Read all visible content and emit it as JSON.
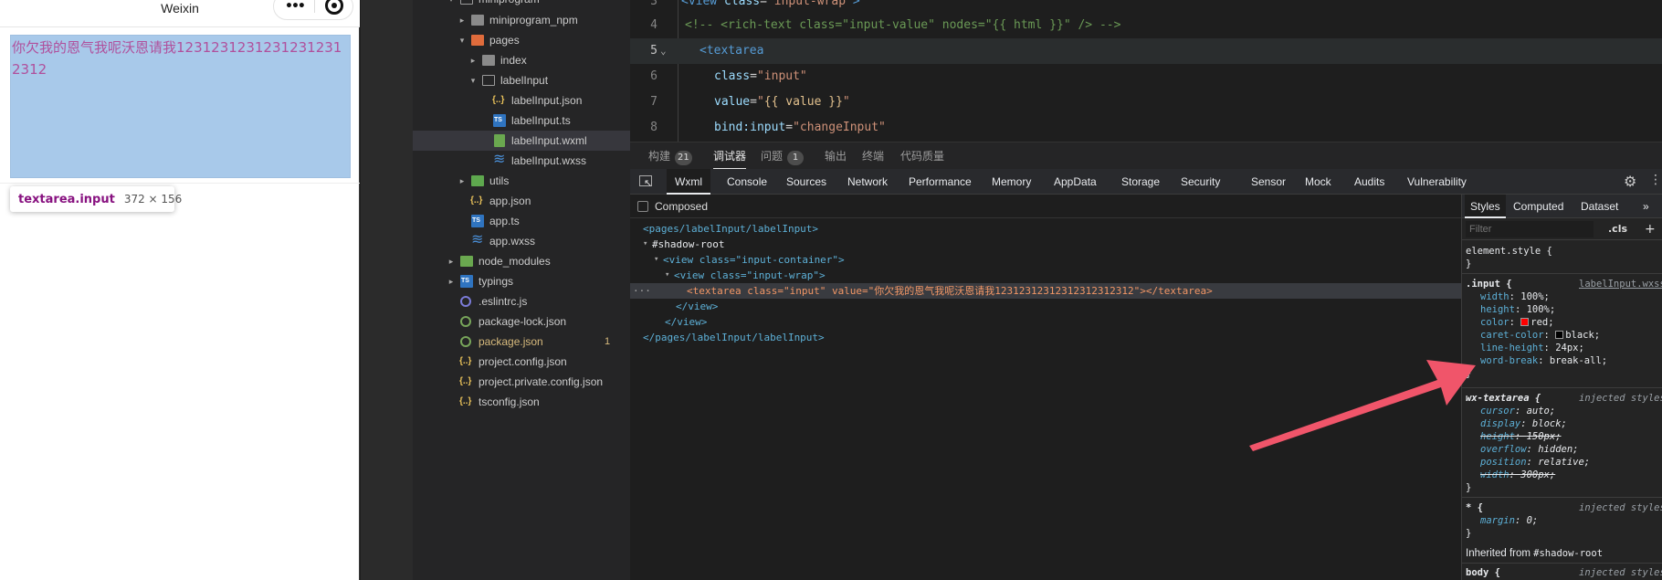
{
  "simulator": {
    "title": "Weixin",
    "textarea_value": "你欠我的恩气我呢沃恩请我12312312312312312312312",
    "tooltip_tag": "textarea.input",
    "tooltip_size": "372 × 156"
  },
  "explorer": {
    "items": [
      {
        "label": "miniprogram_npm"
      },
      {
        "label": "pages"
      },
      {
        "label": "index"
      },
      {
        "label": "labelInput"
      },
      {
        "label": "labelInput.json"
      },
      {
        "label": "labelInput.ts"
      },
      {
        "label": "labelInput.wxml"
      },
      {
        "label": "labelInput.wxss"
      },
      {
        "label": "utils"
      },
      {
        "label": "app.json"
      },
      {
        "label": "app.ts"
      },
      {
        "label": "app.wxss"
      },
      {
        "label": "node_modules"
      },
      {
        "label": "typings"
      },
      {
        "label": ".eslintrc.js"
      },
      {
        "label": "package-lock.json"
      },
      {
        "label": "package.json",
        "badge": "1"
      },
      {
        "label": "project.config.json"
      },
      {
        "label": "project.private.config.json"
      },
      {
        "label": "tsconfig.json"
      }
    ],
    "cut_top_label": "miniprogram"
  },
  "editor": {
    "lines": [
      {
        "num": "3",
        "segments": [
          [
            "c-tag",
            "<view "
          ],
          [
            "c-attr",
            "class"
          ],
          [
            "c-plain",
            "="
          ],
          [
            "c-str",
            "\"input-wrap\""
          ],
          [
            "c-tag",
            ">"
          ]
        ]
      },
      {
        "num": "4",
        "segments": [
          [
            "c-cmt",
            "<!-- <rich-text class=\"input-value\" nodes=\"{{ html }}\" /> -->"
          ]
        ]
      },
      {
        "num": "5",
        "segments": [
          [
            "c-tag",
            "<textarea"
          ]
        ]
      },
      {
        "num": "6",
        "segments": [
          [
            "c-attr",
            "class"
          ],
          [
            "c-plain",
            "="
          ],
          [
            "c-str",
            "\"input\""
          ]
        ]
      },
      {
        "num": "7",
        "segments": [
          [
            "c-attr",
            "value"
          ],
          [
            "c-plain",
            "="
          ],
          [
            "c-str",
            "\""
          ],
          [
            "c-yellow",
            "{{ value }}"
          ],
          [
            "c-str",
            "\""
          ]
        ]
      },
      {
        "num": "8",
        "segments": [
          [
            "c-attr",
            "bind:input"
          ],
          [
            "c-plain",
            "="
          ],
          [
            "c-str",
            "\"changeInput\""
          ]
        ]
      }
    ]
  },
  "panel_tabs": [
    {
      "label": "构建",
      "badge": "21"
    },
    {
      "label": "调试器"
    },
    {
      "label": "问题",
      "badge": "1"
    },
    {
      "label": "输出"
    },
    {
      "label": "终端"
    },
    {
      "label": "代码质量"
    }
  ],
  "devtools_tabs": [
    "Wxml",
    "Console",
    "Sources",
    "Network",
    "Performance",
    "Memory",
    "AppData",
    "Storage",
    "Security",
    "Sensor",
    "Mock",
    "Audits",
    "Vulnerability"
  ],
  "elements": {
    "composed_label": "Composed",
    "lines": [
      "<pages/labelInput/labelInput>",
      "#shadow-root",
      "<view class=\"input-container\">",
      "<view class=\"input-wrap\">",
      "<textarea class=\"input\" value=\"你欠我的恩气我呢沃恩请我12312312312312312312312\"></textarea>",
      "</view>",
      "</view>",
      "</pages/labelInput/labelInput>"
    ],
    "ellipsis": "···"
  },
  "styles_pane": {
    "tabs": [
      "Styles",
      "Computed",
      "Dataset"
    ],
    "more": "»",
    "filter_placeholder": "Filter",
    "cls_label": ".cls",
    "plus_label": "+",
    "element_style": "element.style {",
    "close_brace": "}",
    "input_rule": {
      "selector": ".input {",
      "source": "labelInput.wxss",
      "props": [
        {
          "name": "width",
          "value": "100%;"
        },
        {
          "name": "height",
          "value": "100%;"
        },
        {
          "name": "color",
          "value": "red;",
          "swatch": "#ff0000"
        },
        {
          "name": "caret-color",
          "value": "black;",
          "swatch": "#000000"
        },
        {
          "name": "line-height",
          "value": "24px;"
        },
        {
          "name": "word-break",
          "value": "break-all;"
        }
      ]
    },
    "wx_rule": {
      "selector": "wx-textarea {",
      "source": "injected styles",
      "props": [
        {
          "name": "cursor",
          "value": "auto;"
        },
        {
          "name": "display",
          "value": "block;"
        },
        {
          "name": "height",
          "value": "150px;",
          "struck": true
        },
        {
          "name": "overflow",
          "value": "hidden;"
        },
        {
          "name": "position",
          "value": "relative;"
        },
        {
          "name": "width",
          "value": "300px;",
          "struck": true
        }
      ]
    },
    "star_rule": {
      "selector": "* {",
      "source": "injected styles",
      "props": [
        {
          "name": "margin",
          "value": "0;"
        }
      ]
    },
    "inherited_label": "Inherited from",
    "inherited_from": "#shadow-root",
    "body_rule": {
      "selector": "body {",
      "source": "injected styles"
    }
  },
  "colors": {
    "accent_arrow": "#f0556a",
    "textarea_bg": "#a8c9ea",
    "textarea_text": "#b0509c"
  }
}
